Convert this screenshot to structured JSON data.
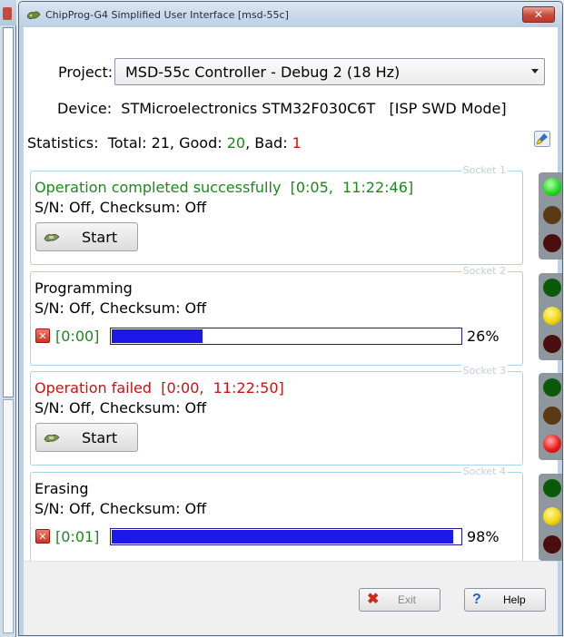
{
  "window": {
    "title": "ChipProg-G4 Simplified User Interface [msd-55c]",
    "close_icon": "x-icon"
  },
  "project": {
    "label": "Project:",
    "value": "MSD-55c Controller - Debug 2 (18 Hz)"
  },
  "device": {
    "label": "Device:",
    "name": "STMicroelectronics STM32F030C6T",
    "mode": "[ISP SWD Mode]"
  },
  "statistics": {
    "label": "Statistics:",
    "total_label": "Total:",
    "total": "21",
    "good_label": "Good:",
    "good": "20",
    "bad_label": "Bad:",
    "bad": "1",
    "clear_icon": "brush-icon"
  },
  "sockets": [
    {
      "title": "Socket 1",
      "status": "Operation completed successfully  [0:05,  11:22:46]",
      "status_color": "#1a8a1a",
      "serial": "S/N: Off, Checksum: Off",
      "button_label": "Start",
      "lamps": {
        "top": "#22dd22",
        "mid": "#5a3a12",
        "bot": "#4a0e0e"
      }
    },
    {
      "title": "Socket 2",
      "status": "Programming",
      "status_color": "#000000",
      "serial": "S/N: Off, Checksum: Off",
      "elapsed": "[0:00]",
      "progress_fraction": 0.26,
      "percent": "26%",
      "lamps": {
        "top": "#0a5a0a",
        "mid": "#f2d60c",
        "bot": "#4a0e0e"
      }
    },
    {
      "title": "Socket 3",
      "status": "Operation failed  [0:00,  11:22:50]",
      "status_color": "#cc1111",
      "serial": "S/N: Off, Checksum: Off",
      "button_label": "Start",
      "lamps": {
        "top": "#0a5a0a",
        "mid": "#5a3a12",
        "bot": "#ee1a1a"
      }
    },
    {
      "title": "Socket 4",
      "status": "Erasing",
      "status_color": "#000000",
      "serial": "S/N: Off, Checksum: Off",
      "elapsed": "[0:01]",
      "progress_fraction": 0.98,
      "percent": "98%",
      "lamps": {
        "top": "#0a5a0a",
        "mid": "#f2d60c",
        "bot": "#4a0e0e"
      }
    }
  ],
  "footer": {
    "exit_label": "Exit",
    "exit_icon": "x-icon",
    "help_label": "Help",
    "help_icon": "question-icon"
  }
}
